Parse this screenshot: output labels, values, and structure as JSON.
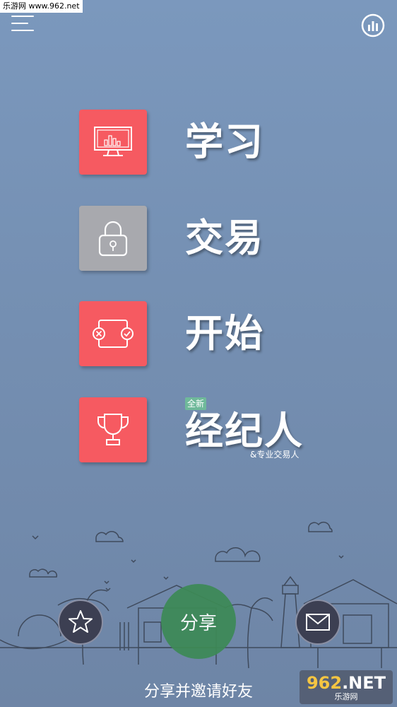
{
  "watermark": "乐游网 www.962.net",
  "menu": [
    {
      "label": "学习",
      "icon": "monitor-chart-icon"
    },
    {
      "label": "交易",
      "icon": "lock-icon"
    },
    {
      "label": "开始",
      "icon": "compare-icon"
    },
    {
      "label": "经纪人",
      "icon": "trophy-icon",
      "badge": "全新",
      "sub": "&专业交易人"
    }
  ],
  "share": {
    "label": "分享"
  },
  "invite": "分享并邀请好友",
  "logo": {
    "num": "962",
    "suffix": ".NET",
    "sub": "乐游网"
  },
  "colors": {
    "tile_red": "#f65a61",
    "tile_gray": "#a8a9ae",
    "share_green": "#3d8a56",
    "badge_green": "#6fb99a"
  }
}
